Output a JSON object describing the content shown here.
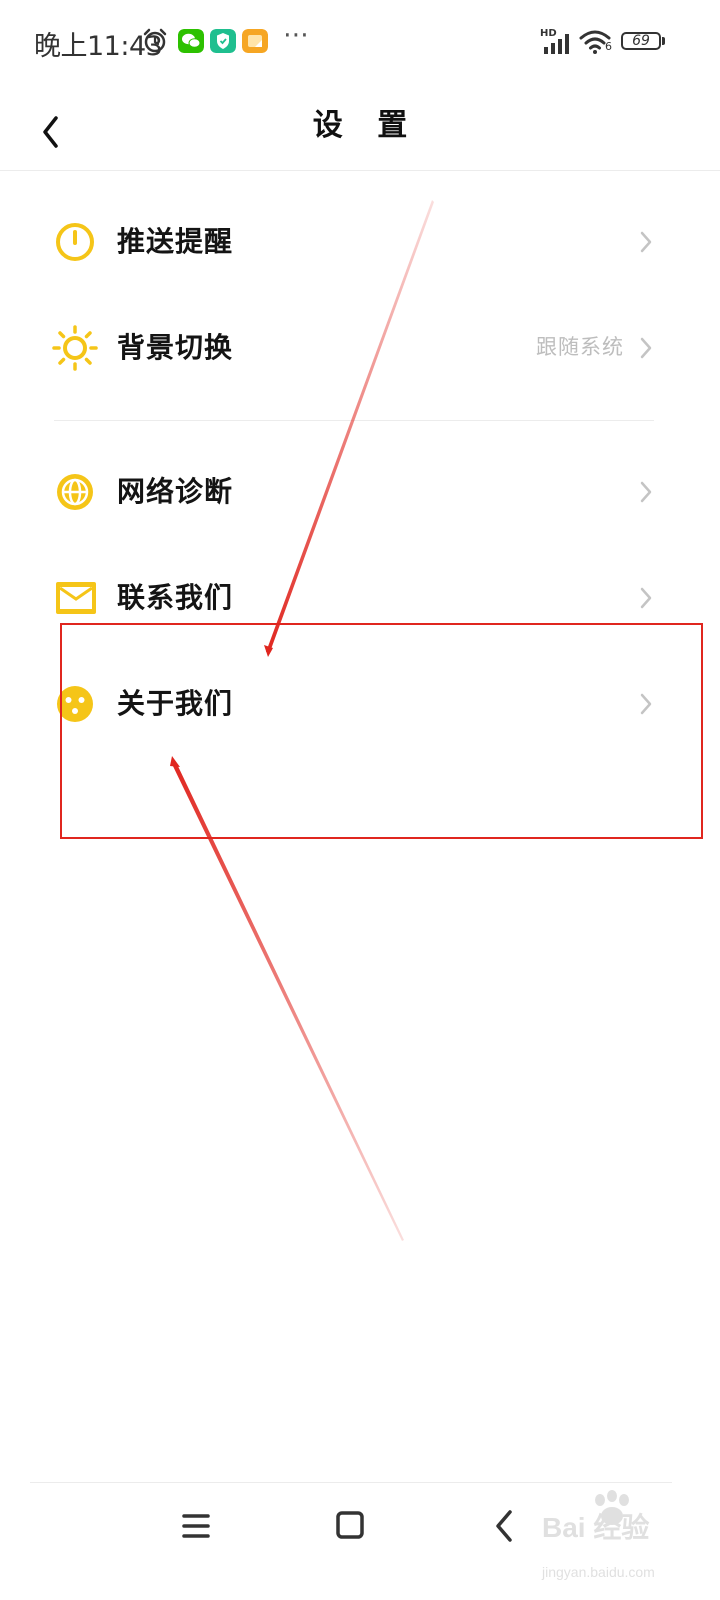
{
  "status_bar": {
    "time": "晚上11:43",
    "network_label": "HD",
    "wifi_sub": "6",
    "battery": "69"
  },
  "header": {
    "title": "设 置",
    "back_icon": "chevron-left-icon"
  },
  "menu": [
    {
      "label": "推送提醒",
      "value": "",
      "icon": "clock-icon"
    },
    {
      "label": "背景切换",
      "value": "跟随系统",
      "icon": "sun-icon"
    },
    {
      "label": "网络诊断",
      "value": "",
      "icon": "globe-icon"
    },
    {
      "label": "联系我们",
      "value": "",
      "icon": "mail-icon"
    },
    {
      "label": "关于我们",
      "value": "",
      "icon": "smiley-icon"
    }
  ],
  "watermark": {
    "brand": "Bai 经验",
    "url": "jingyan.baidu.com"
  },
  "colors": {
    "accent_yellow": "#f5c518",
    "annotation_red": "#e0261f",
    "wechat_green": "#2dc100",
    "shield_green": "#1fbf8f",
    "note_orange": "#f6a623"
  }
}
